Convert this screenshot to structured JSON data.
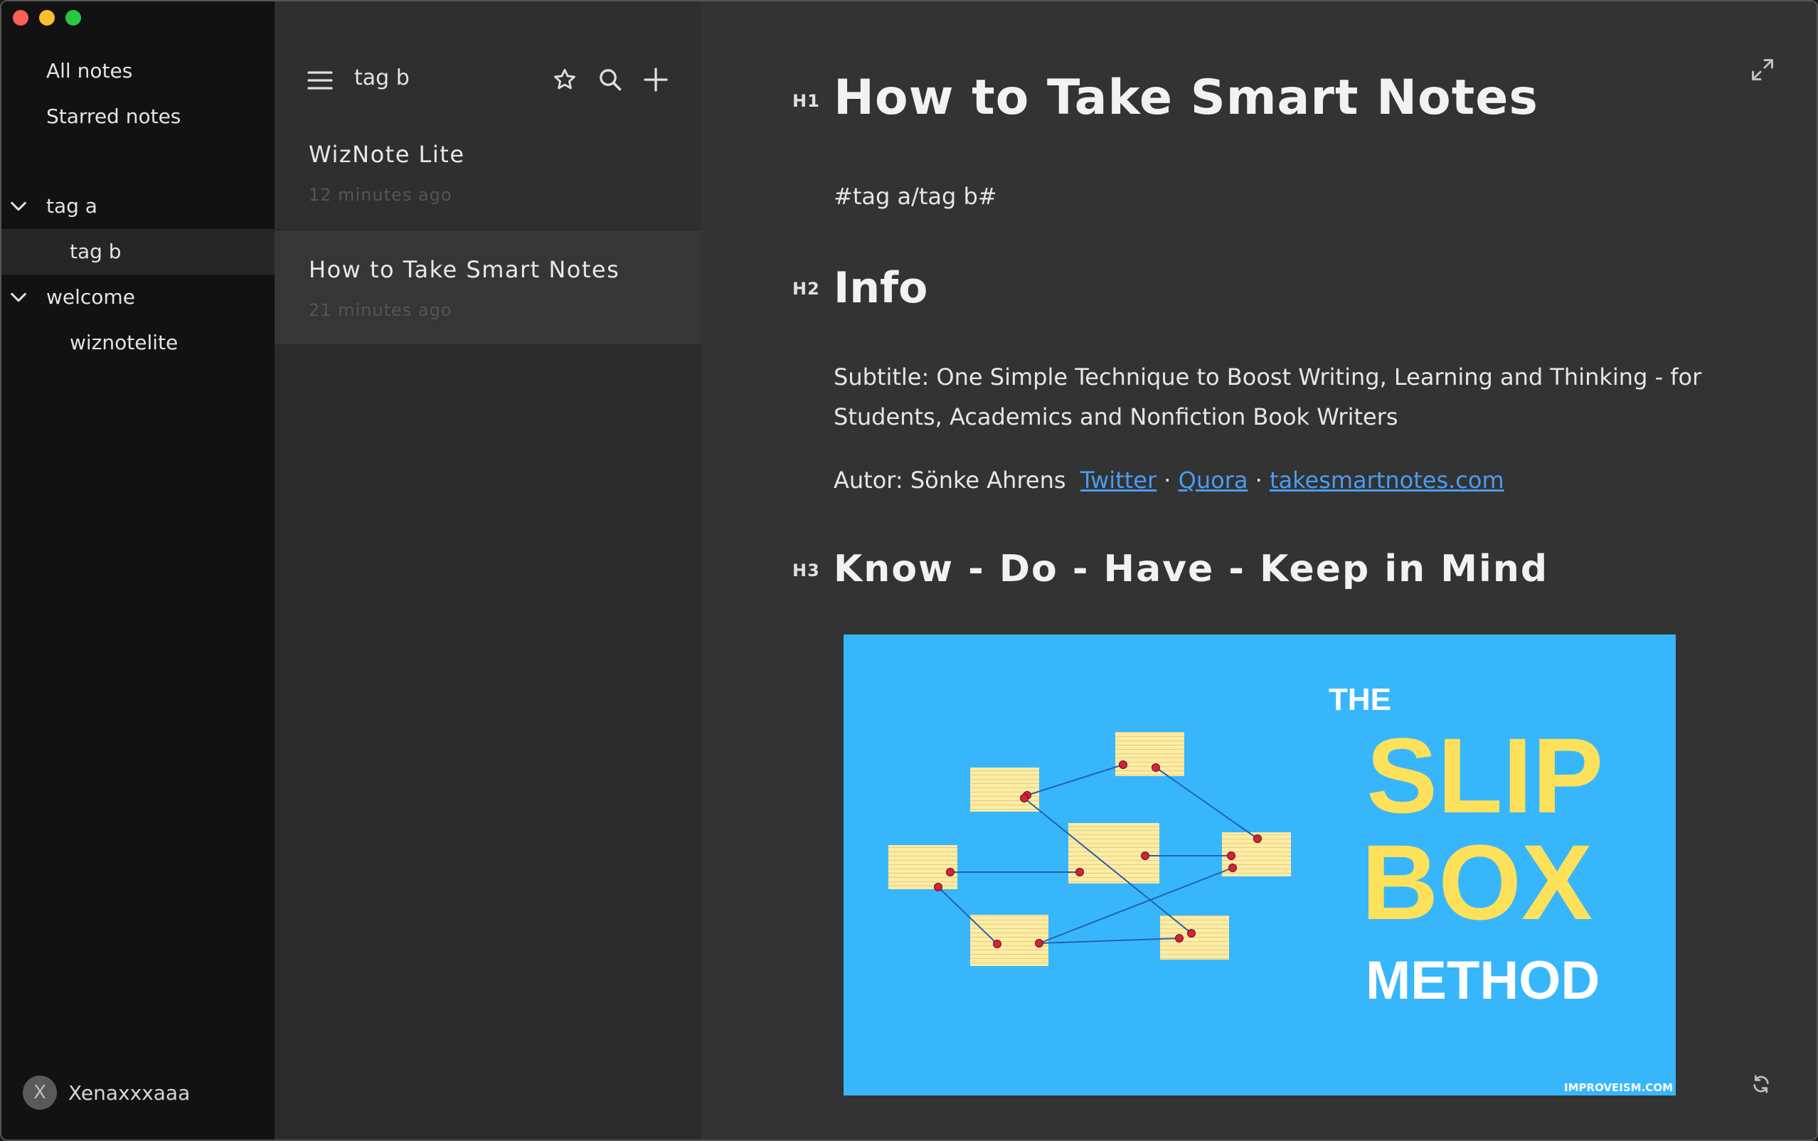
{
  "sidebar": {
    "nav": [
      {
        "label": "All notes"
      },
      {
        "label": "Starred notes"
      }
    ],
    "tags": [
      {
        "label": "tag a"
      },
      {
        "label": "tag b"
      },
      {
        "label": "welcome"
      },
      {
        "label": "wiznotelite"
      }
    ],
    "user": {
      "avatar_letter": "X",
      "name": "Xenaxxxaaa"
    }
  },
  "notelist": {
    "title": "tag b",
    "icons": [
      "menu-icon",
      "star-icon",
      "search-icon",
      "plus-icon"
    ],
    "notes": [
      {
        "title": "WizNote Lite",
        "time": "12 minutes ago"
      },
      {
        "title": "How to Take Smart Notes",
        "time": "21 minutes ago"
      }
    ]
  },
  "editor": {
    "h1_marker": "H1",
    "h1": "How to Take Smart Notes",
    "tagline": "#tag a/tag b#",
    "h2_marker": "H2",
    "h2": "Info",
    "subtitle_line1": "Subtitle: One Simple Technique to Boost Writing, Learning and Thinking - for",
    "subtitle_line2": "Students, Academics and Nonfiction Book Writers",
    "autor_prefix": "Autor: Sönke Ahrens",
    "link_twitter": "Twitter",
    "link_quora": "Quora",
    "link_site": "takesmartnotes.com",
    "separator": "·",
    "h3_marker": "H3",
    "h3": "Know - Do - Have - Keep in Mind",
    "image": {
      "the": "THE",
      "slip": "SLIP",
      "box": "BOX",
      "method": "METHOD",
      "credit": "IMPROVEISM.COM",
      "bg_color": "#38b6fc",
      "accent_color": "#fde15b"
    },
    "icons": [
      "expand-icon",
      "sync-icon"
    ]
  }
}
